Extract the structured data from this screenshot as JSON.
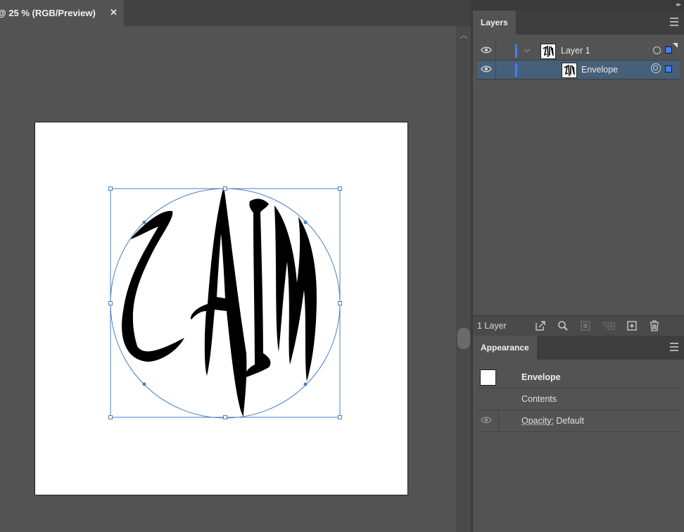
{
  "document": {
    "tab_title": "@ 25 % (RGB/Preview)",
    "close_glyph": "✕"
  },
  "layers_panel": {
    "tab_label": "Layers",
    "rows": [
      {
        "name": "Layer 1",
        "expanded": true,
        "color": "#3f7fff"
      },
      {
        "name": "Envelope",
        "selected": true,
        "color": "#3f7fff"
      }
    ],
    "footer": {
      "count_label": "1 Layer",
      "icons": [
        "export-icon",
        "locate-object-icon",
        "make-clipping-mask-icon",
        "move-to-layer-icon",
        "new-layer-icon",
        "delete-icon"
      ]
    }
  },
  "appearance_panel": {
    "tab_label": "Appearance",
    "object_name": "Envelope",
    "contents_label": "Contents",
    "opacity_label": "Opacity:",
    "opacity_value": "Default"
  },
  "artwork": {
    "description_icon": "envelope-distorted-lettering",
    "selection_color": "#4a7fc1"
  }
}
